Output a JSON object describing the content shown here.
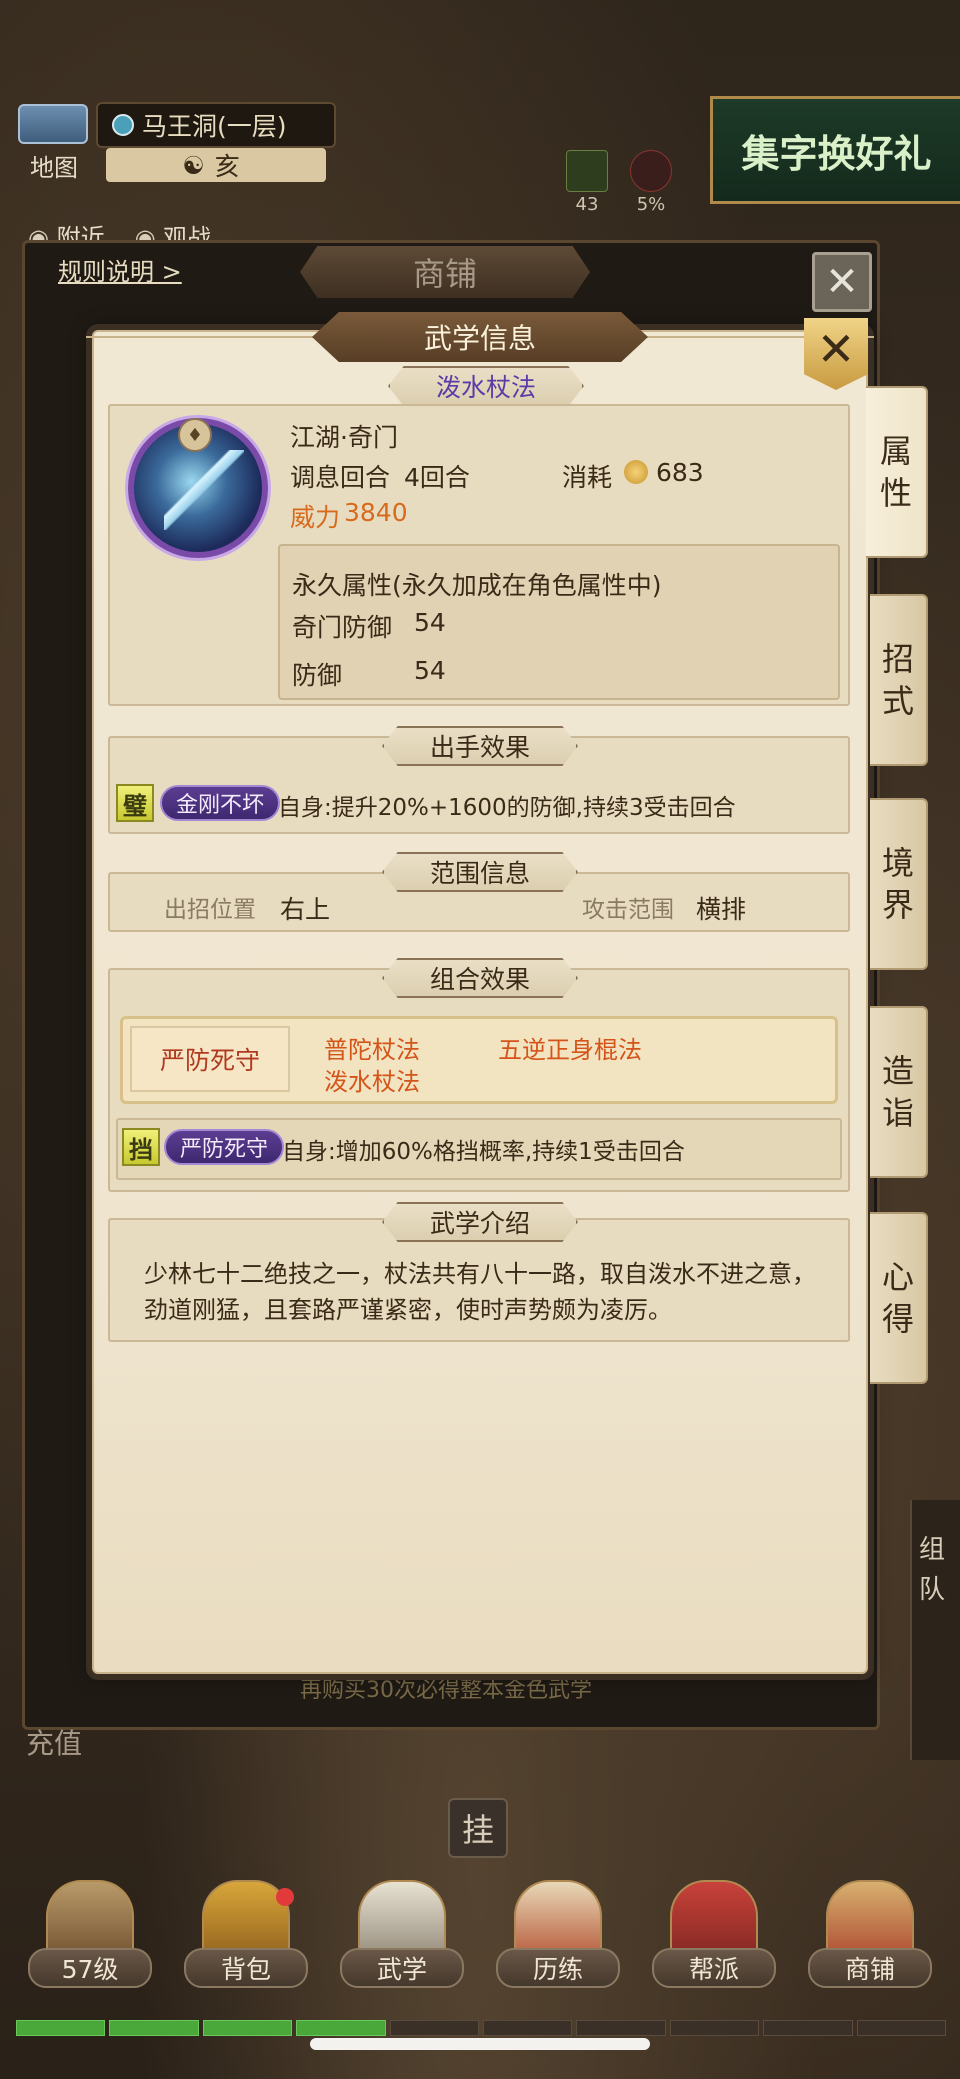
{
  "hud": {
    "map_label": "地图",
    "location": "马王洞(一层)",
    "time": "亥",
    "stat_1": "43",
    "stat_2": "5%",
    "event_banner": "集字换好礼",
    "nearby": "附近",
    "watch": "观战"
  },
  "shop": {
    "title": "商铺",
    "rules_link": "规则说明 >",
    "close": "✕",
    "footer_text": "再购买30次必得整本金色武学",
    "left_label": "充值",
    "hang_button": "挂",
    "team_label": "组队"
  },
  "modal": {
    "title": "武学信息",
    "close": "✕",
    "skill_name": "泼水杖法",
    "category": "江湖·奇门",
    "cooldown_label": "调息回合",
    "cooldown_value": "4回合",
    "cost_label": "消耗",
    "cost_value": "683",
    "power_label": "威力",
    "power_value": "3840",
    "permanent_title": "永久属性(永久加成在角色属性中)",
    "permanent_stats": [
      {
        "label": "奇门防御",
        "value": "54"
      },
      {
        "label": "防御",
        "value": "54"
      }
    ],
    "sections": {
      "effect": "出手效果",
      "range": "范围信息",
      "combo": "组合效果",
      "intro": "武学介绍"
    },
    "effect": {
      "tag": "璧",
      "buff_name": "金刚不坏",
      "description": "自身:提升20%+1600的防御,持续3受击回合"
    },
    "range": {
      "position_label": "出招位置",
      "position_value": "右上",
      "attack_label": "攻击范围",
      "attack_value": "横排"
    },
    "combo": {
      "name": "严防死守",
      "skills": [
        "普陀杖法",
        "五逆正身棍法",
        "泼水杖法"
      ],
      "tag": "挡",
      "buff_name": "严防死守",
      "description": "自身:增加60%格挡概率,持续1受击回合"
    },
    "intro": "少林七十二绝技之一，杖法共有八十一路，取自泼水不进之意，劲道刚猛，且套路严谨紧密，使时声势颇为凌厉。"
  },
  "side_tabs": [
    {
      "label": "属性",
      "active": true
    },
    {
      "label": "招式",
      "active": false
    },
    {
      "label": "境界",
      "active": false
    },
    {
      "label": "造诣",
      "active": false
    },
    {
      "label": "心得",
      "active": false
    }
  ],
  "bottom_nav": [
    {
      "label": "57级"
    },
    {
      "label": "背包"
    },
    {
      "label": "武学"
    },
    {
      "label": "历练"
    },
    {
      "label": "帮派"
    },
    {
      "label": "商铺"
    }
  ],
  "xp_progress": 0.43
}
